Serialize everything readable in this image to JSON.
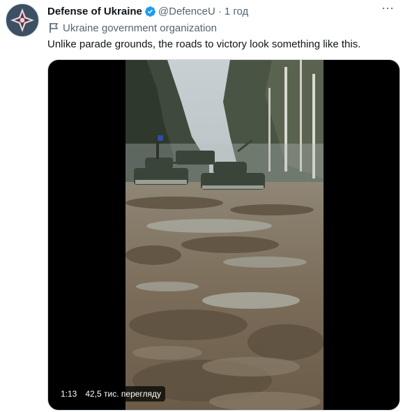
{
  "tweet": {
    "display_name": "Defense of Ukraine",
    "handle": "@DefenceU",
    "separator": "·",
    "time": "1 год",
    "label": "Ukraine government organization",
    "text": "Unlike parade grounds, the roads to victory look something like this.",
    "more": "···"
  },
  "video": {
    "duration": "1:13",
    "views": "42,5 тис. перегляду"
  },
  "icons": {
    "verified": "verified-badge-icon",
    "label": "flag-icon",
    "more": "more-icon",
    "avatar": "ministry-emblem"
  },
  "colors": {
    "verified": "#1d9bf0",
    "secondary_text": "#536471",
    "primary_text": "#0f1419",
    "avatar_bg": "#3d4f63"
  }
}
